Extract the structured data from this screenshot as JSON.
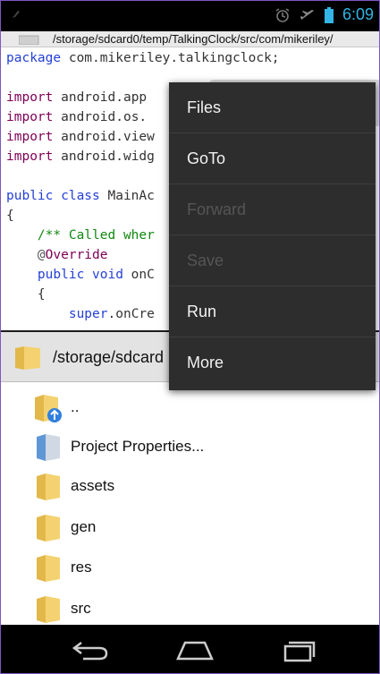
{
  "status_bar": {
    "time": "6:09",
    "icons": [
      "usb-debug-icon",
      "alarm-icon",
      "airplane-mode-icon",
      "battery-icon"
    ]
  },
  "path_bar": {
    "path": "/storage/sdcard0/temp/TalkingClock/src/com/mikeriley/"
  },
  "editor": {
    "lines": [
      "package com.mikeriley.talkingclock;",
      "",
      "import android.app",
      "import android.os.",
      "import android.view",
      "import android.widg",
      "",
      "public class MainAc",
      "{",
      "    /** Called wher",
      "    @Override",
      "    public void onC",
      "    {",
      "        super.onCre"
    ]
  },
  "file_browser": {
    "header_path": "/storage/sdcard",
    "items": [
      {
        "label": "..",
        "icon": "folder-up-icon"
      },
      {
        "label": "Project Properties...",
        "icon": "properties-file-icon"
      },
      {
        "label": "assets",
        "icon": "folder-icon"
      },
      {
        "label": "gen",
        "icon": "folder-icon"
      },
      {
        "label": "res",
        "icon": "folder-icon"
      },
      {
        "label": "src",
        "icon": "folder-icon"
      }
    ]
  },
  "menu": {
    "items": [
      {
        "label": "Files",
        "enabled": true
      },
      {
        "label": "GoTo",
        "enabled": true
      },
      {
        "label": "Forward",
        "enabled": false
      },
      {
        "label": "Save",
        "enabled": false
      },
      {
        "label": "Run",
        "enabled": true
      },
      {
        "label": "More",
        "enabled": true
      }
    ]
  },
  "nav_bar": {
    "buttons": [
      "back-icon",
      "home-icon",
      "recents-icon"
    ]
  },
  "colors": {
    "accent": "#33b5e5",
    "menu_bg": "#2d2d2d",
    "menu_disabled": "#555555",
    "keyword": "#7f0055",
    "comment": "#118811"
  }
}
